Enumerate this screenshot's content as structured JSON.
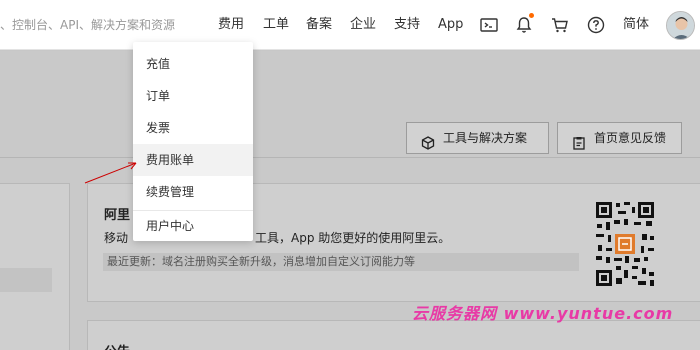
{
  "search": {
    "placeholder": "、控制台、API、解决方案和资源"
  },
  "nav": {
    "items": [
      "费用",
      "工单",
      "备案",
      "企业",
      "支持",
      "App"
    ],
    "language": "简体",
    "icons": [
      "terminal-icon",
      "bell-icon",
      "cart-icon",
      "help-icon"
    ],
    "notification_dot_color": "#ff6a00"
  },
  "dropdown": {
    "items": [
      "充值",
      "订单",
      "发票",
      "费用账单",
      "续费管理",
      "用户中心"
    ],
    "active_item": "费用账单"
  },
  "buttons": {
    "tools": "工具与解决方案",
    "feedback": "首页意见反馈"
  },
  "card": {
    "title": "阿里",
    "desc_start": "移动",
    "desc_end": "工具，App 助您更好的使用阿里云。",
    "update": "最近更新：域名注册购买全新升级，消息增加自定义订阅能力等"
  },
  "notice": {
    "title": "公告"
  },
  "watermark": "云服务器网 www.yuntue.com",
  "colors": {
    "accent": "#ff6a00",
    "arrow": "#cc0000",
    "watermark": "#e83aa6"
  }
}
